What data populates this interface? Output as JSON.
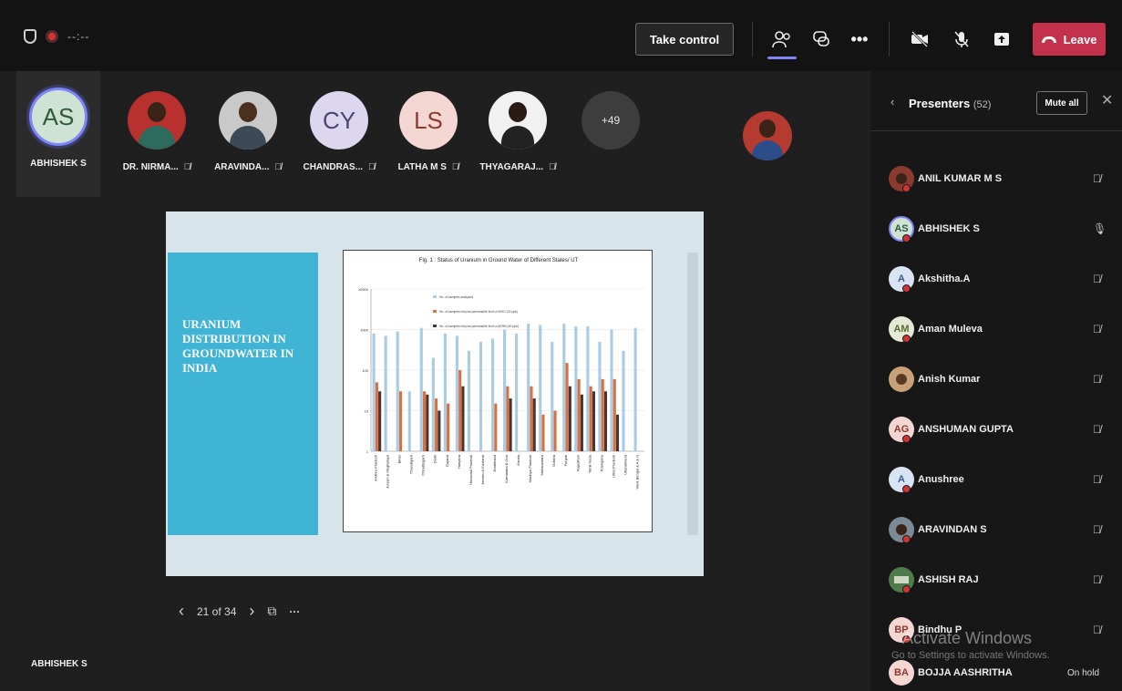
{
  "toolbar": {
    "timer": "--:--",
    "take_control_label": "Take control",
    "leave_label": "Leave"
  },
  "participants": [
    {
      "initials": "AS",
      "name": "ABHISHEK S",
      "muted": false
    },
    {
      "initials": "",
      "name": "DR. NIRMA...",
      "muted": true
    },
    {
      "initials": "",
      "name": "ARAVINDA...",
      "muted": true
    },
    {
      "initials": "CY",
      "name": "CHANDRAS...",
      "muted": true
    },
    {
      "initials": "LS",
      "name": "LATHA M S",
      "muted": true
    },
    {
      "initials": "",
      "name": "THYAGARAJ...",
      "muted": true
    },
    {
      "initials": "+49",
      "name": "",
      "muted": false
    }
  ],
  "slide": {
    "title": "URANIUM DISTRIBUTION IN GROUNDWATER IN INDIA",
    "chart_caption": "Fig. 1 : Status of Uranium in Ground Water of Different States/ UT"
  },
  "slide_nav": {
    "position": "21 of 34"
  },
  "speaker_name": "ABHISHEK S",
  "panel": {
    "title": "Presenters",
    "count": "(52)",
    "mute_all_label": "Mute all",
    "presenters": [
      {
        "initials": "",
        "name": "ANIL KUMAR M S",
        "status": ""
      },
      {
        "initials": "AS",
        "name": "ABHISHEK S",
        "status": ""
      },
      {
        "initials": "A",
        "name": "Akshitha.A",
        "status": ""
      },
      {
        "initials": "AM",
        "name": "Aman Muleva",
        "status": ""
      },
      {
        "initials": "",
        "name": "Anish Kumar",
        "status": ""
      },
      {
        "initials": "AG",
        "name": "ANSHUMAN GUPTA",
        "status": ""
      },
      {
        "initials": "A",
        "name": "Anushree",
        "status": ""
      },
      {
        "initials": "",
        "name": "ARAVINDAN S",
        "status": ""
      },
      {
        "initials": "",
        "name": "ASHISH RAJ",
        "status": ""
      },
      {
        "initials": "BP",
        "name": "Bindhu P",
        "status": ""
      },
      {
        "initials": "BA",
        "name": "BOJJA AASHRITHA",
        "status": "On hold"
      }
    ]
  },
  "watermark": {
    "title": "Activate Windows",
    "subtitle": "Go to Settings to activate Windows."
  },
  "chart_data": {
    "type": "bar",
    "title": "Fig. 1 : Status of Uranium in Ground Water of Different States/ UT",
    "legend": [
      "No. of samples analysed",
      "No. of samples beyond permissible limit of WHO (30 ppb)",
      "No. of samples beyond permissible limit of AERB (60 ppb)"
    ],
    "yticks": [
      "1",
      "10",
      "100",
      "1000",
      "10000"
    ],
    "log_scale": true,
    "categories": [
      "Andhra Pradesh",
      "Assam & Meghalaya",
      "Bihar",
      "Chandigarh",
      "Chhattisgarh",
      "Delhi",
      "Gujarat",
      "Haryana",
      "Himachal Pradesh",
      "Jammu & Kashmir",
      "Jharkhand",
      "Karnataka & Goa",
      "Kerala",
      "Madhya Pradesh",
      "Maharashtra",
      "Odisha",
      "Punjab",
      "Rajasthan",
      "Tamil Nadu",
      "Telangana",
      "Uttar Pradesh",
      "Uttarakhand",
      "West Bengal & A & N"
    ],
    "series": [
      {
        "name": "No. of samples analysed",
        "values": [
          800,
          700,
          900,
          30,
          1100,
          200,
          800,
          700,
          300,
          500,
          600,
          1000,
          800,
          1400,
          1300,
          500,
          1400,
          1200,
          1200,
          500,
          1000,
          300,
          1100
        ]
      },
      {
        "name": "No. of samples beyond permissible limit of WHO (30 ppb)",
        "values": [
          50,
          0,
          30,
          0,
          30,
          20,
          15,
          100,
          0,
          0,
          15,
          40,
          0,
          40,
          8,
          10,
          150,
          60,
          40,
          60,
          60,
          0,
          0
        ]
      },
      {
        "name": "No. of samples beyond permissible limit of AERB (60 ppb)",
        "values": [
          30,
          0,
          0,
          0,
          25,
          10,
          0,
          40,
          0,
          0,
          0,
          20,
          0,
          20,
          0,
          0,
          40,
          25,
          30,
          30,
          8,
          0,
          0
        ]
      }
    ],
    "colors": [
      "#a9cbe3",
      "#d8703f",
      "#4a3434"
    ]
  }
}
